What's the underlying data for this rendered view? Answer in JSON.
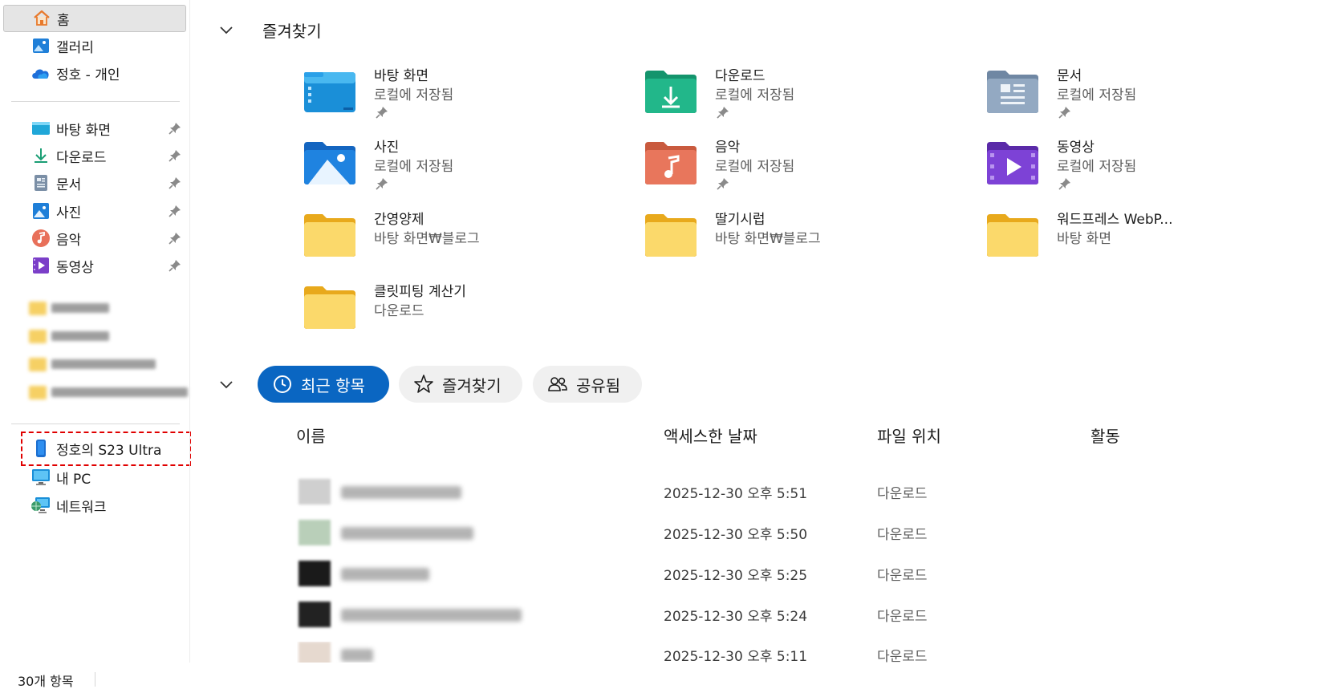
{
  "sidebar": {
    "home": "홈",
    "gallery": "갤러리",
    "onedrive": "정호 - 개인",
    "pinned": [
      {
        "label": "바탕 화면",
        "icon": "desktop-icon"
      },
      {
        "label": "다운로드",
        "icon": "download-icon"
      },
      {
        "label": "문서",
        "icon": "documents-icon"
      },
      {
        "label": "사진",
        "icon": "pictures-icon"
      },
      {
        "label": "음악",
        "icon": "music-icon"
      },
      {
        "label": "동영상",
        "icon": "videos-icon"
      }
    ],
    "devices": [
      {
        "label": "정호의 S23 Ultra",
        "icon": "phone-icon"
      },
      {
        "label": "내 PC",
        "icon": "pc-icon"
      },
      {
        "label": "네트워크",
        "icon": "network-icon"
      }
    ]
  },
  "status": {
    "item_count": "30개 항목"
  },
  "quick_access": {
    "title": "즐겨찾기",
    "items": [
      {
        "name": "바탕 화면",
        "location": "로컬에 저장됨",
        "pinned": true,
        "icon": "desktop-folder-icon"
      },
      {
        "name": "다운로드",
        "location": "로컬에 저장됨",
        "pinned": true,
        "icon": "downloads-folder-icon"
      },
      {
        "name": "문서",
        "location": "로컬에 저장됨",
        "pinned": true,
        "icon": "documents-folder-icon"
      },
      {
        "name": "사진",
        "location": "로컬에 저장됨",
        "pinned": true,
        "icon": "pictures-folder-icon"
      },
      {
        "name": "음악",
        "location": "로컬에 저장됨",
        "pinned": true,
        "icon": "music-folder-icon"
      },
      {
        "name": "동영상",
        "location": "로컬에 저장됨",
        "pinned": true,
        "icon": "videos-folder-icon"
      },
      {
        "name": "간영양제",
        "location": "바탕 화면₩블로그",
        "pinned": false,
        "icon": "folder-icon"
      },
      {
        "name": "딸기시럽",
        "location": "바탕 화면₩블로그",
        "pinned": false,
        "icon": "folder-icon"
      },
      {
        "name": "워드프레스 WebP...",
        "location": "바탕 화면",
        "pinned": false,
        "icon": "folder-icon"
      },
      {
        "name": "클릿피팅 계산기",
        "location": "다운로드",
        "pinned": false,
        "icon": "folder-icon"
      }
    ]
  },
  "tabs": [
    {
      "label": "최근 항목",
      "icon": "clock-icon",
      "selected": true
    },
    {
      "label": "즐겨찾기",
      "icon": "star-icon",
      "selected": false
    },
    {
      "label": "공유됨",
      "icon": "people-icon",
      "selected": false
    }
  ],
  "columns": {
    "name": "이름",
    "accessed": "액세스한 날짜",
    "location": "파일 위치",
    "activity": "활동"
  },
  "recent": [
    {
      "accessed": "2025-12-30 오후 5:51",
      "location": "다운로드"
    },
    {
      "accessed": "2025-12-30 오후 5:50",
      "location": "다운로드"
    },
    {
      "accessed": "2025-12-30 오후 5:25",
      "location": "다운로드"
    },
    {
      "accessed": "2025-12-30 오후 5:24",
      "location": "다운로드"
    },
    {
      "accessed": "2025-12-30 오후 5:11",
      "location": "다운로드"
    }
  ],
  "colors": {
    "accent": "#0a66c2",
    "folder": "#f5c84a"
  }
}
